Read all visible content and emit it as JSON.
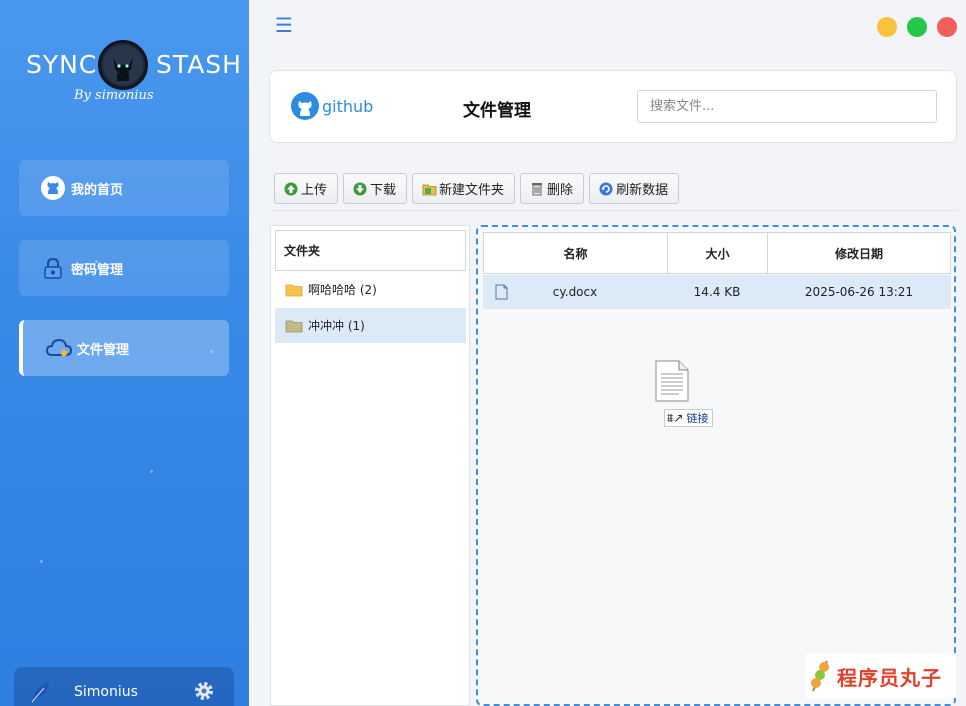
{
  "app": {
    "logo_left": "SYNC",
    "logo_right": "STASH",
    "logo_sub": "By simonius"
  },
  "sidebar": {
    "items": [
      {
        "label": "我的首页",
        "icon": "github-icon"
      },
      {
        "label": "密码管理",
        "icon": "lock-icon"
      },
      {
        "label": "文件管理",
        "icon": "cloud-icon",
        "active": true
      }
    ],
    "user": {
      "name": "Simonius"
    }
  },
  "window_controls": {
    "colors": {
      "minimize": "#fbc23d",
      "maximize": "#25c74a",
      "close": "#f25e5a"
    }
  },
  "header": {
    "github_label": "github",
    "title": "文件管理",
    "search_placeholder": "搜索文件..."
  },
  "toolbar": {
    "upload": "上传",
    "download": "下载",
    "new_folder": "新建文件夹",
    "delete": "删除",
    "refresh": "刷新数据"
  },
  "folders": {
    "header": "文件夹",
    "items": [
      {
        "label": "啊哈哈哈 (2)",
        "selected": false
      },
      {
        "label": "冲冲冲 (1)",
        "selected": true
      }
    ]
  },
  "files": {
    "columns": [
      "名称",
      "大小",
      "修改日期"
    ],
    "rows": [
      {
        "name": "cy.docx",
        "size": "14.4 KB",
        "modified": "2025-06-26 13:21"
      }
    ]
  },
  "drag": {
    "tooltip": "链接"
  },
  "watermark": {
    "text": "程序员丸子"
  },
  "colors": {
    "accent": "#3a8ae8",
    "selected_row": "#dceaf8",
    "drop_border": "#3f8ee0"
  }
}
